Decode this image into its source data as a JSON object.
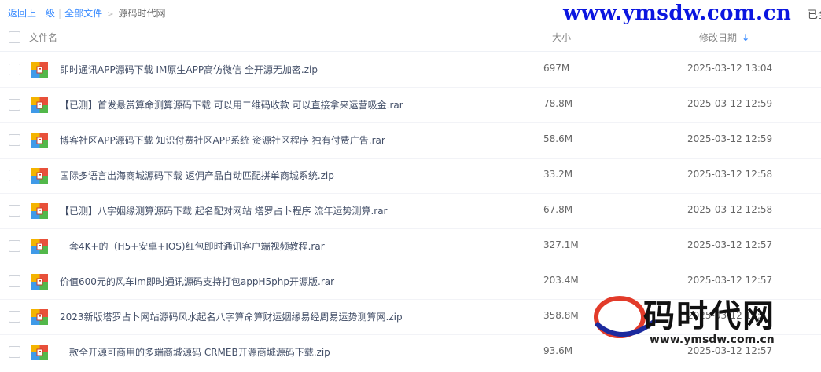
{
  "breadcrumb": {
    "back": "返回上一级",
    "all_files": "全部文件",
    "current": "源码时代网"
  },
  "watermark": {
    "top_url": "www.ymsdw.com.cn",
    "logo_text": "码时代网",
    "bottom_url": "www.ymsdw.com.cn"
  },
  "cut_text": "已全",
  "columns": {
    "name": "文件名",
    "size": "大小",
    "date": "修改日期"
  },
  "files": [
    {
      "name": "即时通讯APP源码下载 IM原生APP高仿微信 全开源无加密.zip",
      "size": "697M",
      "date": "2025-03-12 13:04"
    },
    {
      "name": "【已测】首发悬赏算命测算源码下载 可以用二维码收款 可以直接拿来运营吸金.rar",
      "size": "78.8M",
      "date": "2025-03-12 12:59"
    },
    {
      "name": "博客社区APP源码下载 知识付费社区APP系统 资源社区程序 独有付费广告.rar",
      "size": "58.6M",
      "date": "2025-03-12 12:59"
    },
    {
      "name": "国际多语言出海商城源码下载 返佣产品自动匹配拼单商城系统.zip",
      "size": "33.2M",
      "date": "2025-03-12 12:58"
    },
    {
      "name": "【已测】八字姻缘测算源码下载 起名配对网站 塔罗占卜程序 流年运势测算.rar",
      "size": "67.8M",
      "date": "2025-03-12 12:58"
    },
    {
      "name": "一套4K+的（H5+安卓+IOS)红包即时通讯客户端视频教程.rar",
      "size": "327.1M",
      "date": "2025-03-12 12:57"
    },
    {
      "name": "价值600元的风车im即时通讯源码支持打包appH5php开源版.rar",
      "size": "203.4M",
      "date": "2025-03-12 12:57"
    },
    {
      "name": "2023新版塔罗占卜网站源码风水起名八字算命算财运姻缘易经周易运势测算网.zip",
      "size": "358.8M",
      "date": "2025-03-12 12:57"
    },
    {
      "name": "一款全开源可商用的多端商城源码 CRMEB开源商城源码下载.zip",
      "size": "93.6M",
      "date": "2025-03-12 12:57"
    }
  ],
  "icons": {
    "archive": "archive-file-icon",
    "sort": "sort-desc-arrow-icon"
  },
  "colors": {
    "link": "#3b8cff",
    "watermark_blue": "#0b16e0"
  }
}
